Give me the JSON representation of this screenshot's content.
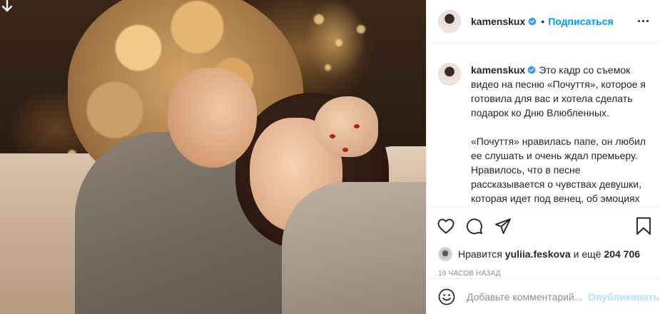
{
  "post": {
    "username": "kamenskux",
    "follow_label": "Подписаться",
    "separator": "•",
    "caption": {
      "paragraph1": "Это кадр со съемок видео на песню «Почуття», которое я готовила для вас и хотела сделать подарок ко Дню Влюбленных.",
      "paragraph2": "«Почуття» нравилась папе, он любил ее слушать и очень ждал премьеру. Нравилось, что в песне рассказывается о чувствах девушки, которая идет под венец, об эмоциях родителей, которые отдают свою"
    },
    "likes": {
      "prefix": "Нравится",
      "liker": "yuliia.feskova",
      "middle": "и ещё",
      "count": "204 706"
    },
    "timestamp": "19 часов назад",
    "composer": {
      "placeholder": "Добавьте комментарий...",
      "post_label": "Опубликовать"
    }
  },
  "icons": {
    "verified": "verified-badge-icon",
    "more": "more-options-icon",
    "like": "heart-icon",
    "comment": "comment-icon",
    "share": "share-icon",
    "save": "bookmark-icon",
    "emoji": "emoji-icon",
    "photo_overlay": "down-arrow-icon"
  },
  "colors": {
    "accent": "#0095f6",
    "post_disabled": "#b2dffc",
    "text": "#262626",
    "muted": "#8e8e8e"
  }
}
